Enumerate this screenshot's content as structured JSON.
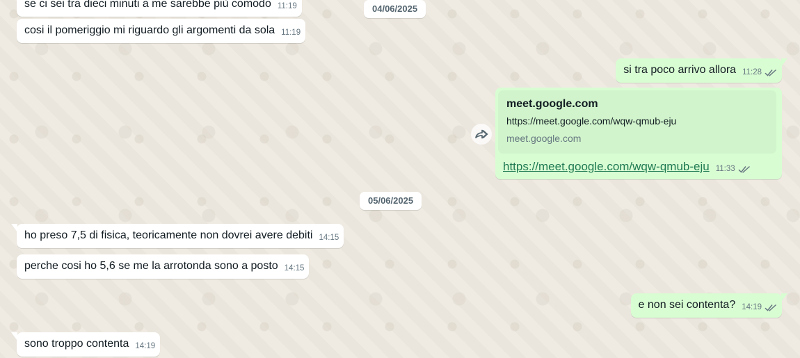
{
  "messages": [
    {
      "text": "se ci sei tra dieci minuti a me sarebbe più comodo",
      "time": "11:19"
    },
    {
      "text": "cosi il pomeriggio mi riguardo gli argomenti da sola",
      "time": "11:19"
    },
    {
      "text": "si tra poco arrivo allora",
      "time": "11:28"
    },
    {
      "preview_title": "meet.google.com",
      "preview_url": "https://meet.google.com/wqw-qmub-eju",
      "preview_domain": "meet.google.com",
      "text": "https://meet.google.com/wqw-qmub-eju",
      "time": "11:33"
    },
    {
      "text": "ho preso 7,5 di fisica, teoricamente non dovrei avere debiti",
      "time": "14:15"
    },
    {
      "text": "perche cosi ho 5,6 se me la arrotonda sono a posto",
      "time": "14:15"
    },
    {
      "text": "e non sei contenta?",
      "time": "14:19"
    },
    {
      "text": "sono troppo contenta",
      "time": "14:19"
    }
  ],
  "dates": [
    "04/06/2025",
    "05/06/2025"
  ],
  "icons": {
    "forward": "forward-icon",
    "read_receipt": "double-check-icon"
  },
  "colors": {
    "incoming_bubble": "#ffffff",
    "outgoing_bubble": "#d9fdd3",
    "preview_background": "#d1f4cc",
    "meta_text": "#667781",
    "wallpaper": "#efeae2"
  }
}
